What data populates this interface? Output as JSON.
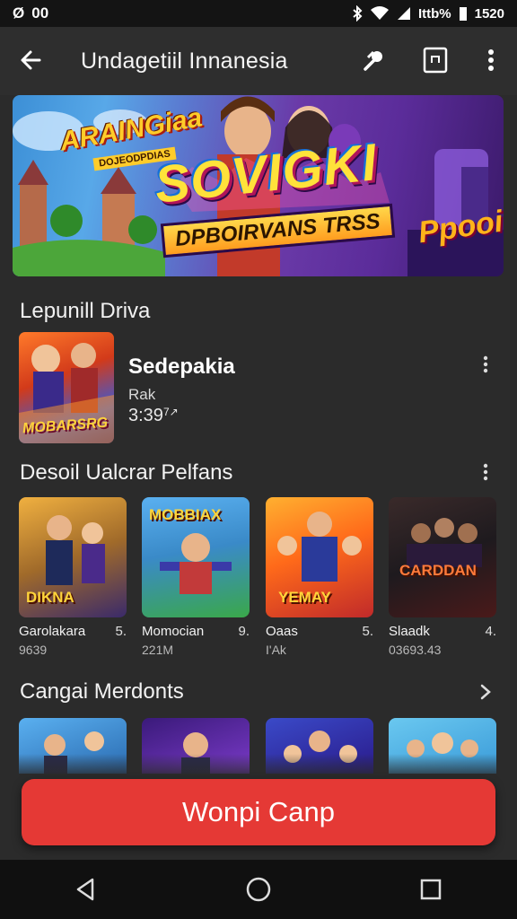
{
  "status_bar": {
    "left_glyph": "Ø",
    "left_text": "00",
    "battery_text": "Ittb%",
    "time": "1520"
  },
  "app_bar": {
    "title": "Undagetiil Innanesia",
    "back_icon": "arrow-left-icon",
    "share_icon": "share-icon",
    "cast_icon": "cast-icon",
    "more_icon": "more-vertical-icon"
  },
  "banner": {
    "left_title": "ARAINGiaa",
    "left_sub": "DOJEODPDIAS",
    "main_title": "SOVIGKI",
    "sub_title": "DPBOIRVANS TRSS",
    "right_title": "Ppooi"
  },
  "sections": {
    "popular": {
      "title": "Lepunill Driva"
    },
    "details": {
      "title": "Desoil Ualcrar Pelfans"
    },
    "more": {
      "title": "Cangai Merdonts"
    }
  },
  "featured": {
    "art_label": "MOBARSRG",
    "name": "Sedepakia",
    "rank": "Rak",
    "rating": "3:39",
    "rating_suffix": "7↗"
  },
  "cards": [
    {
      "art_label": "DIKNA",
      "name": "Garolakara",
      "rank": "5.",
      "meta": "9639"
    },
    {
      "art_label": "MOBBIAX",
      "name": "Momocian",
      "rank": "9.",
      "meta": "221M"
    },
    {
      "art_label": "YEMAY",
      "name": "Oaas",
      "rank": "5.",
      "meta": "I'Ak"
    },
    {
      "art_label": "CARDDAN",
      "name": "Slaadk",
      "rank": "4.",
      "meta": "03693.43"
    }
  ],
  "cta": {
    "label": "Wonpi Canp",
    "color": "#e53935"
  },
  "nav": {
    "back_icon": "triangle-back-icon",
    "home_icon": "circle-home-icon",
    "recents_icon": "square-recents-icon"
  }
}
